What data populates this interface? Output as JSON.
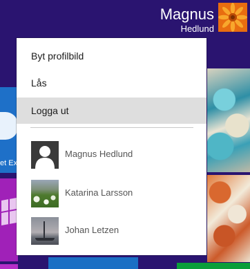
{
  "user": {
    "first_name": "Magnus",
    "last_name": "Hedlund",
    "avatar_icon": "orange-flower-icon"
  },
  "background_tiles": {
    "ie_caption": "et Ex"
  },
  "menu": {
    "items": [
      {
        "label": "Byt profilbild"
      },
      {
        "label": "Lås"
      },
      {
        "label": "Logga ut"
      }
    ],
    "accounts": [
      {
        "name": "Magnus Hedlund",
        "picture": "default-user-silhouette-icon"
      },
      {
        "name": "Katarina Larsson",
        "picture": "meadow-photo"
      },
      {
        "name": "Johan Letzen",
        "picture": "sailboat-photo"
      }
    ]
  },
  "colors": {
    "start_background": "#2a1470",
    "menu_background": "#ffffff",
    "menu_hover": "#dedede",
    "tile_blue": "#1e70c8",
    "tile_purple": "#a021b8",
    "avatar_orange": "#f08a14"
  }
}
